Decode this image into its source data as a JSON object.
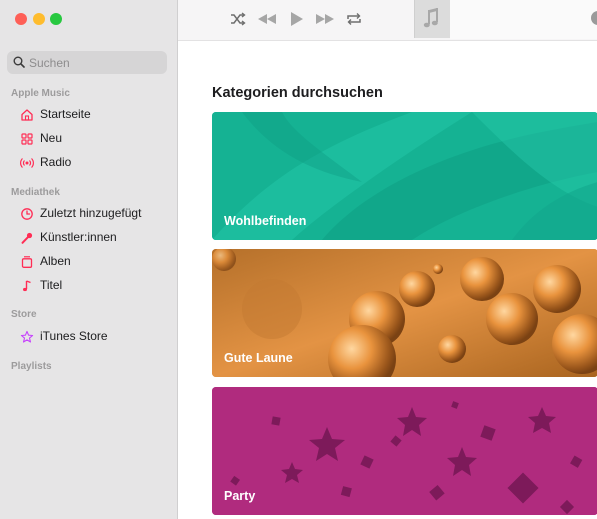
{
  "window": {
    "traffic_lights": [
      "#fe5f57",
      "#febc2e",
      "#28c840"
    ]
  },
  "sidebar": {
    "search_placeholder": "Suchen",
    "sections": [
      {
        "title": "Apple Music",
        "items": [
          {
            "label": "Startseite",
            "icon": "house-icon"
          },
          {
            "label": "Neu",
            "icon": "grid-icon"
          },
          {
            "label": "Radio",
            "icon": "radio-waves-icon"
          }
        ]
      },
      {
        "title": "Mediathek",
        "items": [
          {
            "label": "Zuletzt hinzugefügt",
            "icon": "clock-icon"
          },
          {
            "label": "Künstler:innen",
            "icon": "microphone-icon"
          },
          {
            "label": "Alben",
            "icon": "album-stack-icon"
          },
          {
            "label": "Titel",
            "icon": "music-note-icon"
          }
        ]
      },
      {
        "title": "Store",
        "items": [
          {
            "label": "iTunes Store",
            "icon": "star-icon"
          }
        ]
      },
      {
        "title": "Playlists",
        "items": []
      }
    ],
    "accent_color": "#ff2d55",
    "store_color": "#c643fc"
  },
  "toolbar": {
    "controls": [
      "shuffle-icon",
      "previous-icon",
      "play-icon",
      "next-icon",
      "repeat-icon"
    ]
  },
  "main": {
    "heading": "Kategorien durchsuchen",
    "categories": [
      {
        "label": "Wohlbefinden",
        "color": "#17b69a"
      },
      {
        "label": "Gute Laune",
        "color": "#e08a34"
      },
      {
        "label": "Party",
        "color": "#b32c80"
      }
    ]
  }
}
